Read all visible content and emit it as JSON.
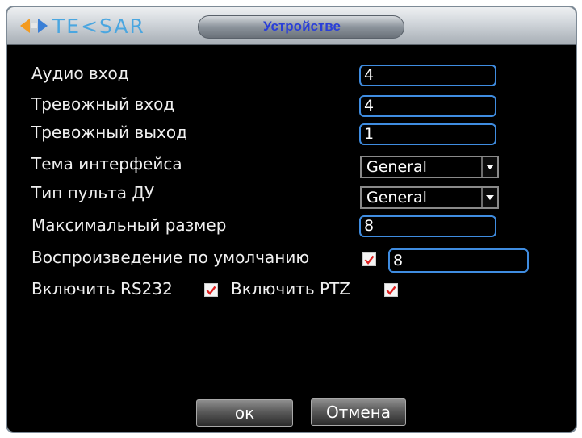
{
  "header": {
    "logo_text": "TE<SAR",
    "title": "Устройстве"
  },
  "form": {
    "audio_in": {
      "label": "Аудио вход",
      "value": "4"
    },
    "alarm_in": {
      "label": "Тревожный вход",
      "value": "4"
    },
    "alarm_out": {
      "label": "Тревожный выход",
      "value": "1"
    },
    "theme": {
      "label": "Тема интерфейса",
      "value": "General"
    },
    "remote_type": {
      "label": "Тип пульта ДУ",
      "value": "General"
    },
    "max_size": {
      "label": "Максимальный размер",
      "value": "8"
    },
    "default_playback": {
      "label": "Воспроизведение по умолчанию",
      "checked": true,
      "value": "8"
    },
    "rs232": {
      "label": "Включить RS232",
      "checked": true
    },
    "ptz": {
      "label": "Включить PTZ",
      "checked": true
    }
  },
  "buttons": {
    "ok": "ок",
    "cancel": "Отмена"
  },
  "colors": {
    "accent": "#3f8ce0",
    "title_text": "#2a3fd8",
    "check": "#e02020"
  },
  "icons": {
    "logo": "arrows-logo-icon",
    "dropdown": "chevron-down-icon",
    "check": "checkmark-icon"
  }
}
